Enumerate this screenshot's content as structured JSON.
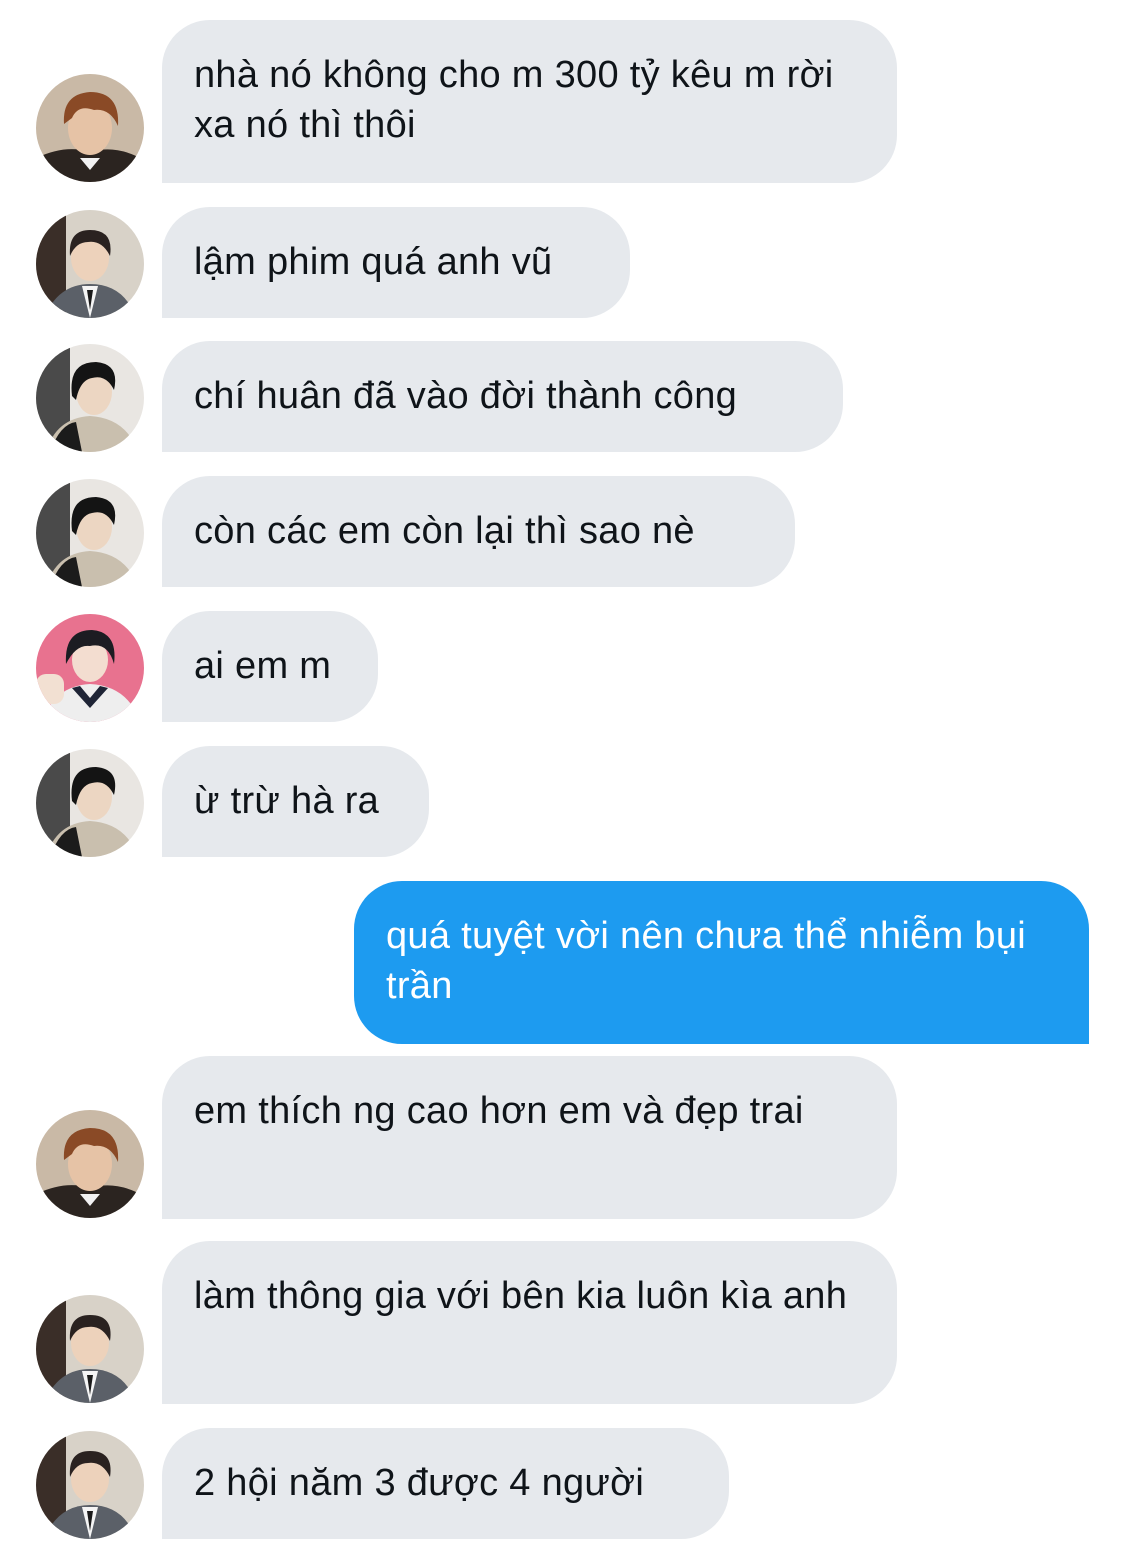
{
  "colors": {
    "incoming_bubble": "#e6e9ed",
    "outgoing_bubble": "#1d9bf0",
    "incoming_text": "#0f1419",
    "outgoing_text": "#ffffff"
  },
  "messages": [
    {
      "direction": "incoming",
      "avatar": "avatar-brown-hair",
      "text": "nhà nó không cho m 300 tỷ kêu m rời xa nó thì thôi"
    },
    {
      "direction": "incoming",
      "avatar": "avatar-suit",
      "text": "lậm phim quá anh vũ"
    },
    {
      "direction": "incoming",
      "avatar": "avatar-dark-hair",
      "text": "chí huân đã vào đời thành công"
    },
    {
      "direction": "incoming",
      "avatar": "avatar-dark-hair",
      "text": "còn các em còn lại thì sao nè"
    },
    {
      "direction": "incoming",
      "avatar": "avatar-pink-background",
      "text": "ai em m"
    },
    {
      "direction": "incoming",
      "avatar": "avatar-dark-hair",
      "text": "ừ trừ hà ra"
    },
    {
      "direction": "outgoing",
      "text": "quá tuyệt vời nên chưa thể nhiễm bụi trần"
    },
    {
      "direction": "incoming",
      "avatar": "avatar-brown-hair",
      "text": "em thích ng cao hơn em và đẹp trai"
    },
    {
      "direction": "incoming",
      "avatar": "avatar-suit",
      "text": "làm thông gia với bên kia luôn kìa anh"
    },
    {
      "direction": "incoming",
      "avatar": "avatar-suit",
      "text": "2 hội năm 3 được 4 người"
    }
  ]
}
